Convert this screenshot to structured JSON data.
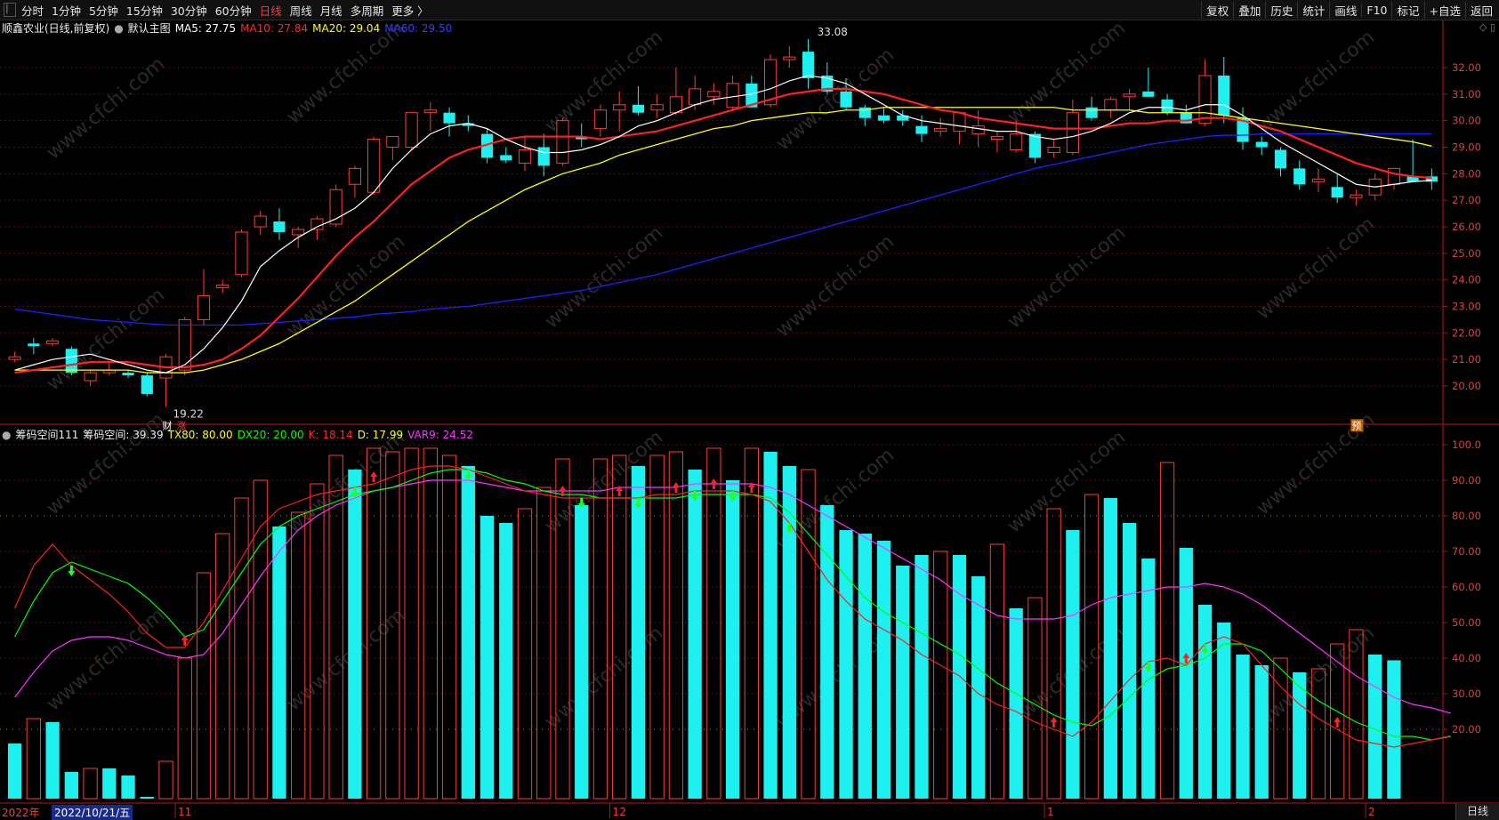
{
  "toolbar": {
    "period_tabs": [
      {
        "label": "分时",
        "active": false
      },
      {
        "label": "1分钟",
        "active": false
      },
      {
        "label": "5分钟",
        "active": false
      },
      {
        "label": "15分钟",
        "active": false
      },
      {
        "label": "30分钟",
        "active": false
      },
      {
        "label": "60分钟",
        "active": false
      },
      {
        "label": "日线",
        "active": true
      },
      {
        "label": "周线",
        "active": false
      },
      {
        "label": "月线",
        "active": false
      },
      {
        "label": "多周期",
        "active": false
      },
      {
        "label": "更多 〉",
        "active": false
      }
    ],
    "right_buttons": [
      "复权",
      "叠加",
      "历史",
      "统计",
      "画线",
      "F10",
      "标记",
      "+自选",
      "返回"
    ]
  },
  "main_legend": {
    "stock": "顺鑫农业(日线,前复权)",
    "template": "默认主图",
    "ma5": "MA5: 27.75",
    "ma10": "MA10: 27.84",
    "ma20": "MA20: 29.04",
    "ma60": "MA60: 29.50",
    "colors": {
      "ma5": "#ffffff",
      "ma10": "#ff2020",
      "ma20": "#ffff00",
      "ma60": "#2020ff"
    }
  },
  "price_axis": [
    "32.00",
    "31.00",
    "30.00",
    "29.00",
    "28.00",
    "27.00",
    "26.00",
    "25.00",
    "24.00",
    "23.00",
    "22.00",
    "21.00",
    "20.00"
  ],
  "annotations": {
    "high": "33.08",
    "low": "19.22",
    "cai": "财",
    "zhang": "涨",
    "yu": "预"
  },
  "sub_legend": {
    "name": "筹码空间111",
    "value": "筹码空间: 39.39",
    "tx80": "TX80: 80.00",
    "dx20": "DX20: 20.00",
    "k": "K: 18.14",
    "d": "D: 17.99",
    "var9": "VAR9: 24.52"
  },
  "sub_axis": [
    "100.0",
    "90.00",
    "80.00",
    "70.00",
    "60.00",
    "50.00",
    "40.00",
    "30.00",
    "20.00"
  ],
  "date_axis": {
    "year": "2022年",
    "cursor_date": "2022/10/21/五",
    "months": [
      "11",
      "12",
      "1",
      "2"
    ]
  },
  "period_label": "日线",
  "watermark": "www.cfchi.com",
  "chart_data": {
    "type": "candlestick",
    "candles": [
      [
        21.0,
        21.3,
        20.9,
        21.1
      ],
      [
        21.6,
        21.8,
        21.2,
        21.5
      ],
      [
        21.6,
        21.8,
        21.5,
        21.7
      ],
      [
        21.4,
        21.5,
        20.4,
        20.5
      ],
      [
        20.2,
        20.6,
        20.0,
        20.5
      ],
      [
        20.5,
        20.9,
        20.4,
        20.6
      ],
      [
        20.5,
        20.6,
        20.3,
        20.4
      ],
      [
        20.4,
        20.5,
        19.6,
        19.7
      ],
      [
        20.3,
        21.2,
        19.22,
        21.1
      ],
      [
        20.6,
        22.6,
        20.4,
        22.5
      ],
      [
        22.5,
        24.4,
        22.3,
        23.4
      ],
      [
        23.7,
        24.0,
        23.5,
        23.8
      ],
      [
        24.2,
        25.9,
        24.1,
        25.8
      ],
      [
        26.0,
        26.6,
        25.7,
        26.4
      ],
      [
        26.2,
        26.7,
        25.5,
        25.8
      ],
      [
        25.7,
        26.0,
        25.2,
        25.9
      ],
      [
        25.9,
        26.4,
        25.5,
        26.3
      ],
      [
        26.1,
        27.6,
        26.0,
        27.4
      ],
      [
        27.6,
        28.3,
        27.1,
        28.2
      ],
      [
        27.3,
        29.4,
        27.2,
        29.3
      ],
      [
        29.0,
        29.4,
        28.5,
        29.4
      ],
      [
        29.0,
        30.3,
        28.9,
        30.3
      ],
      [
        30.3,
        30.7,
        29.6,
        30.4
      ],
      [
        30.3,
        30.5,
        29.4,
        29.9
      ],
      [
        29.9,
        30.2,
        29.6,
        29.8
      ],
      [
        29.5,
        29.7,
        28.4,
        28.6
      ],
      [
        28.7,
        29.0,
        28.4,
        28.5
      ],
      [
        28.4,
        29.4,
        28.1,
        28.9
      ],
      [
        29.0,
        29.5,
        27.9,
        28.3
      ],
      [
        28.4,
        30.1,
        28.3,
        30.0
      ],
      [
        29.4,
        29.9,
        29.0,
        29.3
      ],
      [
        29.7,
        30.6,
        29.4,
        30.4
      ],
      [
        30.4,
        31.1,
        29.6,
        30.6
      ],
      [
        30.6,
        31.3,
        30.2,
        30.3
      ],
      [
        30.4,
        31.0,
        30.1,
        30.6
      ],
      [
        30.3,
        32.0,
        30.2,
        30.9
      ],
      [
        30.6,
        31.7,
        30.4,
        31.2
      ],
      [
        30.9,
        31.4,
        30.6,
        31.1
      ],
      [
        30.5,
        31.7,
        30.4,
        31.4
      ],
      [
        31.4,
        31.7,
        30.5,
        30.5
      ],
      [
        30.6,
        32.5,
        30.5,
        32.3
      ],
      [
        32.3,
        32.8,
        32.0,
        32.4
      ],
      [
        32.6,
        33.08,
        31.2,
        31.6
      ],
      [
        31.7,
        32.2,
        31.0,
        31.1
      ],
      [
        31.1,
        31.6,
        30.4,
        30.5
      ],
      [
        30.5,
        30.6,
        29.8,
        30.1
      ],
      [
        30.2,
        30.5,
        29.9,
        30.0
      ],
      [
        30.2,
        30.4,
        29.8,
        30.0
      ],
      [
        29.8,
        30.2,
        29.2,
        29.5
      ],
      [
        29.6,
        30.1,
        29.4,
        29.7
      ],
      [
        29.6,
        30.0,
        29.1,
        30.3
      ],
      [
        29.5,
        30.4,
        29.0,
        29.8
      ],
      [
        29.3,
        29.6,
        28.8,
        29.4
      ],
      [
        28.9,
        30.0,
        28.8,
        29.5
      ],
      [
        29.5,
        29.6,
        28.4,
        28.6
      ],
      [
        28.8,
        29.3,
        28.6,
        29.0
      ],
      [
        28.8,
        30.8,
        28.7,
        30.3
      ],
      [
        30.5,
        30.9,
        30.0,
        30.1
      ],
      [
        30.4,
        30.9,
        30.1,
        30.8
      ],
      [
        30.9,
        31.2,
        30.4,
        31.0
      ],
      [
        31.1,
        32.0,
        30.9,
        30.9
      ],
      [
        30.8,
        31.0,
        30.2,
        30.3
      ],
      [
        30.3,
        30.6,
        29.9,
        29.9
      ],
      [
        29.9,
        32.3,
        29.8,
        31.7
      ],
      [
        31.7,
        32.4,
        29.9,
        30.2
      ],
      [
        30.1,
        30.5,
        28.9,
        29.2
      ],
      [
        29.2,
        29.4,
        28.7,
        29.0
      ],
      [
        28.9,
        29.0,
        27.9,
        28.2
      ],
      [
        28.2,
        28.5,
        27.4,
        27.6
      ],
      [
        27.7,
        28.2,
        27.3,
        27.8
      ],
      [
        27.5,
        28.0,
        26.9,
        27.1
      ],
      [
        27.1,
        27.4,
        26.8,
        27.2
      ],
      [
        27.2,
        28.0,
        27.0,
        27.8
      ],
      [
        27.6,
        28.2,
        27.4,
        28.2
      ],
      [
        27.9,
        29.3,
        27.7,
        27.7
      ],
      [
        27.9,
        28.2,
        27.4,
        27.7
      ]
    ],
    "ma5": [
      20.6,
      20.8,
      21.0,
      21.1,
      21.2,
      21.0,
      20.8,
      20.6,
      20.5,
      20.8,
      21.4,
      22.2,
      23.2,
      24.5,
      25.1,
      25.6,
      26.0,
      26.3,
      26.7,
      27.3,
      28.2,
      28.9,
      29.5,
      29.8,
      29.9,
      29.7,
      29.3,
      29.0,
      28.8,
      28.8,
      28.9,
      29.1,
      29.4,
      29.8,
      30.0,
      30.3,
      30.6,
      30.8,
      30.9,
      31.0,
      31.2,
      31.5,
      31.7,
      31.6,
      31.4,
      31.0,
      30.6,
      30.2,
      30.0,
      29.9,
      29.8,
      29.7,
      29.6,
      29.6,
      29.4,
      29.3,
      29.4,
      29.6,
      29.9,
      30.3,
      30.5,
      30.5,
      30.4,
      30.6,
      30.6,
      30.2,
      29.7,
      29.2,
      28.8,
      28.4,
      28.0,
      27.6,
      27.5,
      27.6,
      27.7,
      27.75
    ],
    "ma10": [
      20.5,
      20.6,
      20.7,
      20.8,
      20.9,
      20.9,
      20.9,
      20.8,
      20.7,
      20.7,
      20.8,
      21.0,
      21.4,
      21.9,
      22.6,
      23.3,
      24.1,
      24.9,
      25.6,
      26.2,
      26.9,
      27.6,
      28.1,
      28.6,
      28.9,
      29.1,
      29.3,
      29.4,
      29.4,
      29.4,
      29.4,
      29.3,
      29.4,
      29.5,
      29.6,
      29.8,
      30.0,
      30.2,
      30.4,
      30.6,
      30.8,
      31.0,
      31.1,
      31.2,
      31.2,
      31.1,
      31.0,
      30.8,
      30.6,
      30.4,
      30.3,
      30.1,
      30.0,
      29.9,
      29.8,
      29.7,
      29.7,
      29.7,
      29.8,
      29.9,
      29.9,
      30.0,
      30.0,
      30.1,
      30.1,
      30.0,
      29.8,
      29.6,
      29.3,
      29.0,
      28.7,
      28.4,
      28.2,
      28.0,
      27.9,
      27.84
    ],
    "ma20": [
      20.6,
      20.6,
      20.6,
      20.6,
      20.6,
      20.6,
      20.6,
      20.5,
      20.5,
      20.5,
      20.6,
      20.8,
      21.0,
      21.3,
      21.6,
      22.0,
      22.4,
      22.8,
      23.2,
      23.7,
      24.2,
      24.7,
      25.2,
      25.7,
      26.2,
      26.6,
      27.0,
      27.4,
      27.7,
      28.0,
      28.2,
      28.4,
      28.7,
      28.9,
      29.1,
      29.3,
      29.5,
      29.7,
      29.8,
      30.0,
      30.1,
      30.2,
      30.3,
      30.3,
      30.4,
      30.4,
      30.5,
      30.5,
      30.5,
      30.5,
      30.5,
      30.5,
      30.5,
      30.5,
      30.5,
      30.5,
      30.4,
      30.4,
      30.4,
      30.4,
      30.3,
      30.3,
      30.3,
      30.3,
      30.2,
      30.1,
      30.0,
      29.9,
      29.8,
      29.7,
      29.6,
      29.5,
      29.4,
      29.3,
      29.2,
      29.04
    ],
    "ma60": [
      22.9,
      22.8,
      22.7,
      22.6,
      22.5,
      22.45,
      22.4,
      22.35,
      22.3,
      22.3,
      22.3,
      22.3,
      22.3,
      22.35,
      22.4,
      22.45,
      22.5,
      22.55,
      22.6,
      22.7,
      22.75,
      22.8,
      22.9,
      22.95,
      23.0,
      23.1,
      23.2,
      23.3,
      23.4,
      23.5,
      23.6,
      23.75,
      23.9,
      24.05,
      24.2,
      24.4,
      24.6,
      24.8,
      25.0,
      25.2,
      25.4,
      25.6,
      25.8,
      26.0,
      26.2,
      26.4,
      26.6,
      26.8,
      27.0,
      27.2,
      27.4,
      27.6,
      27.8,
      28.0,
      28.2,
      28.35,
      28.5,
      28.65,
      28.8,
      28.95,
      29.1,
      29.2,
      29.3,
      29.4,
      29.45,
      29.45,
      29.5,
      29.5,
      29.5,
      29.5,
      29.5,
      29.5,
      29.5,
      29.5,
      29.5,
      29.5
    ],
    "chip_bars": [
      {
        "v": 16,
        "c": "cyan"
      },
      {
        "v": 23,
        "c": "red"
      },
      {
        "v": 22,
        "c": "cyan"
      },
      {
        "v": 8,
        "c": "cyan"
      },
      {
        "v": 9,
        "c": "red"
      },
      {
        "v": 9,
        "c": "cyan"
      },
      {
        "v": 7,
        "c": "cyan"
      },
      {
        "v": 1,
        "c": "cyan"
      },
      {
        "v": 11,
        "c": "red"
      },
      {
        "v": 40,
        "c": "red"
      },
      {
        "v": 64,
        "c": "red"
      },
      {
        "v": 75,
        "c": "red"
      },
      {
        "v": 85,
        "c": "red"
      },
      {
        "v": 90,
        "c": "red"
      },
      {
        "v": 77,
        "c": "cyan"
      },
      {
        "v": 81,
        "c": "red"
      },
      {
        "v": 89,
        "c": "red"
      },
      {
        "v": 97,
        "c": "red"
      },
      {
        "v": 93,
        "c": "cyan"
      },
      {
        "v": 99,
        "c": "red"
      },
      {
        "v": 98,
        "c": "red"
      },
      {
        "v": 99,
        "c": "red"
      },
      {
        "v": 99,
        "c": "red"
      },
      {
        "v": 97,
        "c": "red"
      },
      {
        "v": 94,
        "c": "cyan"
      },
      {
        "v": 80,
        "c": "cyan"
      },
      {
        "v": 78,
        "c": "cyan"
      },
      {
        "v": 82,
        "c": "red"
      },
      {
        "v": 88,
        "c": "red"
      },
      {
        "v": 96,
        "c": "red"
      },
      {
        "v": 83,
        "c": "cyan"
      },
      {
        "v": 96,
        "c": "red"
      },
      {
        "v": 97,
        "c": "red"
      },
      {
        "v": 94,
        "c": "cyan"
      },
      {
        "v": 97,
        "c": "red"
      },
      {
        "v": 98,
        "c": "red"
      },
      {
        "v": 93,
        "c": "cyan"
      },
      {
        "v": 99,
        "c": "red"
      },
      {
        "v": 90,
        "c": "cyan"
      },
      {
        "v": 99,
        "c": "red"
      },
      {
        "v": 98,
        "c": "cyan"
      },
      {
        "v": 94,
        "c": "cyan"
      },
      {
        "v": 93,
        "c": "red"
      },
      {
        "v": 83,
        "c": "cyan"
      },
      {
        "v": 76,
        "c": "cyan"
      },
      {
        "v": 75,
        "c": "cyan"
      },
      {
        "v": 73,
        "c": "cyan"
      },
      {
        "v": 66,
        "c": "cyan"
      },
      {
        "v": 69,
        "c": "cyan"
      },
      {
        "v": 70,
        "c": "red"
      },
      {
        "v": 69,
        "c": "cyan"
      },
      {
        "v": 63,
        "c": "cyan"
      },
      {
        "v": 72,
        "c": "red"
      },
      {
        "v": 54,
        "c": "cyan"
      },
      {
        "v": 57,
        "c": "red"
      },
      {
        "v": 82,
        "c": "red"
      },
      {
        "v": 76,
        "c": "cyan"
      },
      {
        "v": 86,
        "c": "red"
      },
      {
        "v": 85,
        "c": "cyan"
      },
      {
        "v": 78,
        "c": "cyan"
      },
      {
        "v": 68,
        "c": "cyan"
      },
      {
        "v": 95,
        "c": "red"
      },
      {
        "v": 71,
        "c": "cyan"
      },
      {
        "v": 55,
        "c": "cyan"
      },
      {
        "v": 50,
        "c": "cyan"
      },
      {
        "v": 41,
        "c": "cyan"
      },
      {
        "v": 38,
        "c": "cyan"
      },
      {
        "v": 40,
        "c": "red"
      },
      {
        "v": 36,
        "c": "cyan"
      },
      {
        "v": 37,
        "c": "red"
      },
      {
        "v": 44,
        "c": "red"
      },
      {
        "v": 48,
        "c": "red"
      },
      {
        "v": 41,
        "c": "cyan"
      },
      {
        "v": 39.39,
        "c": "cyan"
      }
    ],
    "k_line": [
      54,
      66,
      72,
      66,
      62,
      58,
      53,
      47,
      43,
      43,
      50,
      59,
      68,
      77,
      82,
      84,
      86,
      87,
      88,
      89,
      91,
      93,
      94,
      94,
      93,
      91,
      89,
      87,
      86,
      85,
      85,
      85,
      85,
      85,
      86,
      86,
      87,
      87,
      87,
      86,
      84,
      78,
      70,
      62,
      56,
      51,
      48,
      45,
      41,
      38,
      35,
      30,
      27,
      25,
      22,
      20,
      18,
      22,
      28,
      34,
      39,
      40,
      38,
      44,
      46,
      44,
      38,
      32,
      27,
      23,
      20,
      17,
      16,
      15,
      16,
      17,
      18.14
    ],
    "d_line": [
      46,
      56,
      64,
      67,
      65,
      63,
      61,
      57,
      52,
      46,
      48,
      56,
      64,
      72,
      77,
      80,
      82,
      84,
      86,
      87,
      88,
      90,
      92,
      93,
      93,
      92,
      90,
      89,
      87,
      86,
      86,
      85,
      85,
      85,
      85,
      85,
      86,
      86,
      86,
      86,
      85,
      81,
      75,
      69,
      63,
      57,
      53,
      50,
      47,
      44,
      41,
      37,
      33,
      30,
      27,
      24,
      22,
      21,
      24,
      29,
      34,
      37,
      38,
      40,
      44,
      44,
      42,
      37,
      32,
      28,
      25,
      22,
      20,
      18,
      18,
      17,
      17.99
    ],
    "var9_line": [
      29,
      36,
      42,
      45,
      46,
      46,
      45,
      43,
      41,
      40,
      41,
      47,
      55,
      63,
      70,
      76,
      80,
      83,
      85,
      87,
      88,
      89,
      90,
      90,
      90,
      89,
      88,
      87,
      87,
      87,
      87,
      87,
      88,
      88,
      88,
      88,
      89,
      89,
      89,
      89,
      88,
      86,
      83,
      80,
      77,
      74,
      71,
      68,
      65,
      62,
      58,
      55,
      52,
      51,
      51,
      51,
      52,
      55,
      57,
      58,
      59,
      60,
      60,
      61,
      60,
      58,
      55,
      51,
      47,
      43,
      39,
      35,
      32,
      29,
      27,
      26,
      24.52
    ],
    "markers": [
      {
        "i": 3,
        "t": "down"
      },
      {
        "i": 9,
        "t": "up"
      },
      {
        "i": 18,
        "t": "down"
      },
      {
        "i": 19,
        "t": "up"
      },
      {
        "i": 24,
        "t": "down"
      },
      {
        "i": 29,
        "t": "up"
      },
      {
        "i": 30,
        "t": "down"
      },
      {
        "i": 32,
        "t": "up"
      },
      {
        "i": 33,
        "t": "down"
      },
      {
        "i": 35,
        "t": "up"
      },
      {
        "i": 36,
        "t": "down"
      },
      {
        "i": 37,
        "t": "up"
      },
      {
        "i": 38,
        "t": "down"
      },
      {
        "i": 39,
        "t": "up"
      },
      {
        "i": 41,
        "t": "down"
      },
      {
        "i": 55,
        "t": "up"
      },
      {
        "i": 60,
        "t": "down"
      },
      {
        "i": 62,
        "t": "up"
      },
      {
        "i": 63,
        "t": "down"
      },
      {
        "i": 70,
        "t": "up"
      }
    ]
  }
}
